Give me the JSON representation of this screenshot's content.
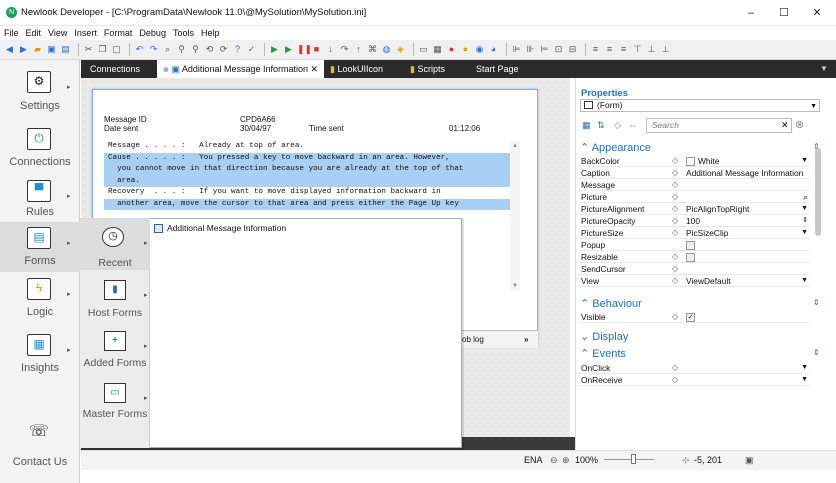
{
  "window": {
    "title": "Newlook Developer - [C:\\ProgramData\\Newlook 11.0\\@MySolution\\MySolution.ini]",
    "minimize": "–",
    "maximize": "☐",
    "close": "✕"
  },
  "menu": [
    "File",
    "Edit",
    "View",
    "Insert",
    "Format",
    "Debug",
    "Tools",
    "Help"
  ],
  "sidebar": {
    "items": [
      {
        "label": "Settings",
        "icon": "gear-icon"
      },
      {
        "label": "Connections",
        "icon": "plug-icon"
      },
      {
        "label": "Rules",
        "icon": "rules-icon"
      },
      {
        "label": "Forms",
        "icon": "forms-icon"
      },
      {
        "label": "Logic",
        "icon": "lightning-icon"
      },
      {
        "label": "Insights",
        "icon": "insights-icon"
      },
      {
        "label": "Contact Us",
        "icon": "contact-icon"
      }
    ]
  },
  "tabs": [
    {
      "label": "Connections"
    },
    {
      "label": "Additional Message Information",
      "close": "✕"
    },
    {
      "label": "LookUIIcon"
    },
    {
      "label": "Scripts"
    },
    {
      "label": "Start Page"
    }
  ],
  "form": {
    "message_id_label": "Message ID",
    "message_id_value": "CPD6A66",
    "date_sent_label": "Date sent",
    "date_sent_value": "30/04/97",
    "time_sent_label": "Time sent",
    "time_sent_value": "01:12:06",
    "lines": [
      "Message . . . . :   Already at top of area.",
      "Cause . . . . . :   You pressed a key to move backward in an area. However,",
      "  you cannot move in that direction because you are already at the top of that",
      "  area.",
      "Recovery  . . . :   If you want to move displayed information backward in",
      "  another area, move the cursor to that area and press either the Page Up key"
    ],
    "joblog": "ob log",
    "joblog_arrow": "»"
  },
  "popup": {
    "items": [
      {
        "label": "Recent"
      },
      {
        "label": "Host Forms"
      },
      {
        "label": "Added Forms"
      },
      {
        "label": "Master Forms"
      }
    ],
    "entry": "Additional Message Information"
  },
  "properties": {
    "title": "Properties",
    "object": "(Form)",
    "search_placeholder": "Search",
    "categories": {
      "appearance": "Appearance",
      "behaviour": "Behaviour",
      "display": "Display",
      "events": "Events"
    },
    "appearance_rows": [
      {
        "name": "BackColor",
        "value": "White"
      },
      {
        "name": "Caption",
        "value": "Additional Message Information"
      },
      {
        "name": "Message",
        "value": ""
      },
      {
        "name": "Picture",
        "value": ""
      },
      {
        "name": "PictureAlignment",
        "value": "PicAlignTopRight"
      },
      {
        "name": "PictureOpacity",
        "value": "100"
      },
      {
        "name": "PictureSize",
        "value": "PicSizeClip"
      },
      {
        "name": "Popup",
        "value": ""
      },
      {
        "name": "Resizable",
        "value": ""
      },
      {
        "name": "SendCursor",
        "value": ""
      },
      {
        "name": "View",
        "value": "ViewDefault"
      }
    ],
    "behaviour_rows": [
      {
        "name": "Visible",
        "value": ""
      }
    ],
    "events_rows": [
      {
        "name": "OnClick",
        "value": ""
      },
      {
        "name": "OnReceive",
        "value": ""
      }
    ]
  },
  "status": {
    "lang": "ENA",
    "zoom": "100%",
    "coords": "-5, 201"
  },
  "colors": {
    "accent": "#1f6fbf",
    "highlight": "#a9cff2",
    "tabbar": "#2b2b2b"
  }
}
